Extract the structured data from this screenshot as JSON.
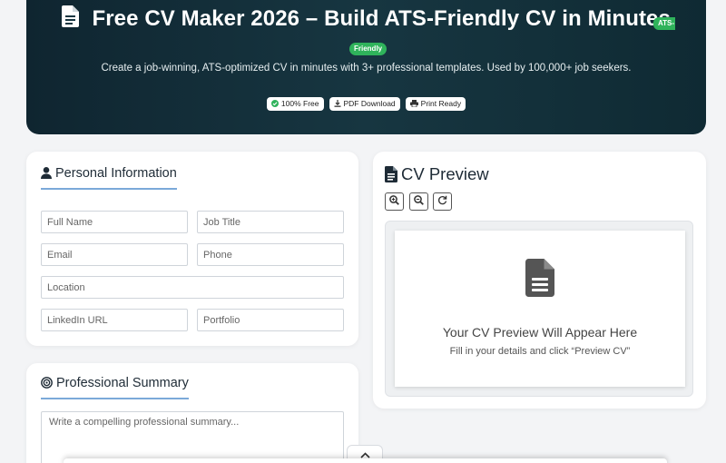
{
  "hero": {
    "title": "Free CV Maker 2026 – Build ATS-Friendly CV in Minutes",
    "badge_cut": "ATS-",
    "badge_wrap": "Friendly",
    "subtitle": "Create a job-winning, ATS-optimized CV in minutes with 3+ professional templates. Used by 100,000+ job seekers.",
    "chips": [
      "100% Free",
      "PDF Download",
      "Print Ready"
    ]
  },
  "personal": {
    "title": "Personal Information",
    "fields": {
      "full_name": "Full Name",
      "job_title": "Job Title",
      "email": "Email",
      "phone": "Phone",
      "location": "Location",
      "linkedin": "LinkedIn URL",
      "portfolio": "Portfolio"
    }
  },
  "summary": {
    "title": "Professional Summary",
    "placeholder": "Write a compelling professional summary..."
  },
  "preview": {
    "title": "CV Preview",
    "heading": "Your CV Preview Will Appear Here",
    "hint": "Fill in your details and click “Preview CV”"
  },
  "icons": {
    "hero": "file-text-icon",
    "chip_free": "check-circle-icon",
    "chip_pdf": "download-icon",
    "chip_print": "printer-icon",
    "personal": "user-icon",
    "summary": "target-icon",
    "preview": "file-text-icon",
    "zoom_in": "zoom-in-icon",
    "zoom_out": "zoom-out-icon",
    "reset": "refresh-icon",
    "collapse": "chevron-up-icon"
  },
  "colors": {
    "hero_bg": "#173641",
    "badge_green": "#2fb35b",
    "accent_underline": "#7ba9d9"
  }
}
